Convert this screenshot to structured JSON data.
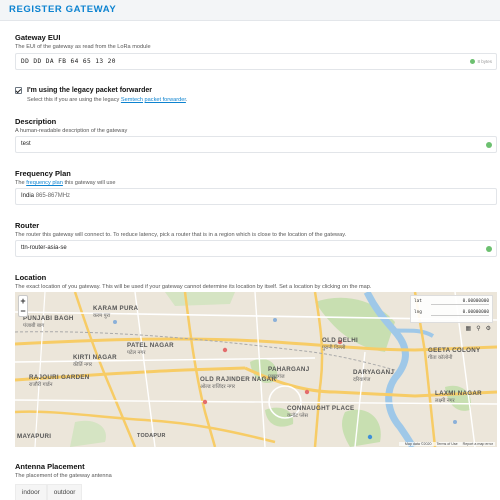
{
  "header": {
    "title": "REGISTER GATEWAY"
  },
  "gateway_eui": {
    "label": "Gateway EUI",
    "description": "The EUI of the gateway as read from the LoRa module",
    "value": "DD  DD  DA  FB  64  65  13  20",
    "byte_count": "8 bytes"
  },
  "legacy_forwarder": {
    "label": "I'm using the legacy packet forwarder",
    "desc_prefix": "Select this if you are using the legacy ",
    "desc_link1": "Semtech",
    "desc_space": " ",
    "desc_link2": "packet forwarder",
    "desc_suffix": ".",
    "checked": true
  },
  "description": {
    "label": "Description",
    "description": "A human-readable description of the gateway",
    "value": "test"
  },
  "frequency_plan": {
    "label": "Frequency Plan",
    "desc_prefix": "The ",
    "desc_link": "frequency plan",
    "desc_suffix": " this gateway will use",
    "value_name": "India",
    "value_range": "865-867MHz"
  },
  "router": {
    "label": "Router",
    "description": "The router this gateway will connect to. To reduce latency, pick a router that is in a region which is close to the location of the gateway.",
    "value": "ttn-router-asia-se"
  },
  "location": {
    "label": "Location",
    "description": "The exact location of you gateway. This will be used if your gateway cannot determine its location by itself. Set a location by clicking on the map.",
    "lat_label": "lat",
    "lat_value": "0.00000000",
    "lng_label": "lng",
    "lng_value": "0.00000000",
    "zoom_in": "+",
    "zoom_out": "−",
    "attribution": [
      "Map data ©2020",
      "Terms of Use",
      "Report a map error"
    ],
    "places": [
      {
        "name": "KARAM PURA",
        "sub": "करम पुरा"
      },
      {
        "name": "PUNJABI BAGH",
        "sub": "पंजाबी बाग"
      },
      {
        "name": "PATEL NAGAR",
        "sub": "पटेल नगर"
      },
      {
        "name": "KIRTI NAGAR",
        "sub": "कीर्ति नगर"
      },
      {
        "name": "RAJOURI GARDEN",
        "sub": "राजौरी गार्डन"
      },
      {
        "name": "OLD RAJINDER NAGAR",
        "sub": "ओल्ड राजिंदर नगर"
      },
      {
        "name": "PAHARGANJ",
        "sub": "पहाड़गंज"
      },
      {
        "name": "CONNAUGHT PLACE",
        "sub": "कनॉट प्लेस"
      },
      {
        "name": "OLD DELHI",
        "sub": "पुरानी दिल्ली"
      },
      {
        "name": "DARYAGANJ",
        "sub": "दरियागंज"
      },
      {
        "name": "GEETA COLONY",
        "sub": "गीता कॉलोनी"
      },
      {
        "name": "LAXMI NAGAR",
        "sub": "लक्ष्मी नगर"
      },
      {
        "name": "MAYAPURI",
        "sub": ""
      },
      {
        "name": "TODAPUR",
        "sub": ""
      }
    ]
  },
  "antenna_placement": {
    "label": "Antenna Placement",
    "description": "The placement of the gateway antenna",
    "options": [
      "indoor",
      "outdoor"
    ]
  },
  "colors": {
    "accent": "#0d83d0",
    "success": "#6cc070",
    "map_land": "#ece6da",
    "map_park": "#c8dfb1",
    "map_river": "#9fc8e8",
    "map_road": "#f7cc66"
  }
}
